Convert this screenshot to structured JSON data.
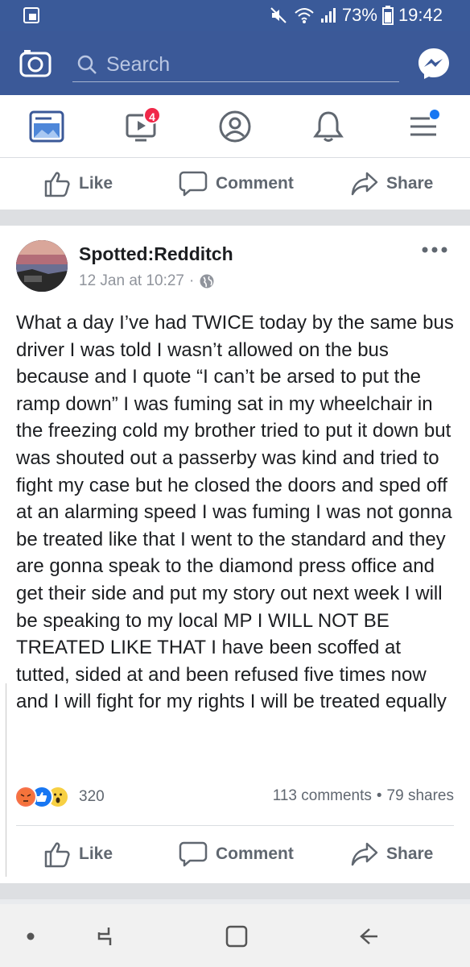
{
  "status_bar": {
    "battery": "73%",
    "time": "19:42",
    "icons": [
      "mute-icon",
      "wifi-icon",
      "signal-icon",
      "battery-icon"
    ]
  },
  "app_bar": {
    "search_placeholder": "Search",
    "brand_color": "#3b5998"
  },
  "tabs": {
    "video_badge": "4",
    "items": [
      "news-feed-icon",
      "watch-icon",
      "profile-icon",
      "notifications-icon",
      "menu-icon"
    ]
  },
  "top_actions": {
    "like": "Like",
    "comment": "Comment",
    "share": "Share"
  },
  "post": {
    "page_name": "Spotted:Redditch",
    "timestamp": "12 Jan at 10:27",
    "separator": "·",
    "body": "What a day I’ve had TWICE today by the same bus driver I was told I wasn’t allowed on the bus because and I quote “I can’t be arsed to put the ramp down” I was fuming sat in my wheelchair in the freezing cold my brother tried to put it down but was shouted out a passerby was kind and tried to fight my case but he closed the doors and sped off at an alarming speed I was fuming I was not gonna be treated like that I went to the standard and they are gonna speak to the diamond press office and get their side and put my story out next week I will be speaking to my local MP I WILL NOT BE TREATED LIKE THAT I have been scoffed at tutted, sided at and been refused five times now and I will fight for my rights I will be treated equally",
    "reaction_count": "320",
    "comments": "113 comments",
    "shares": "79 shares",
    "stat_separator": "•",
    "actions": {
      "like": "Like",
      "comment": "Comment",
      "share": "Share"
    }
  },
  "nav_bar": [
    "recent-apps-dot",
    "recents-icon",
    "home-icon",
    "back-icon"
  ]
}
